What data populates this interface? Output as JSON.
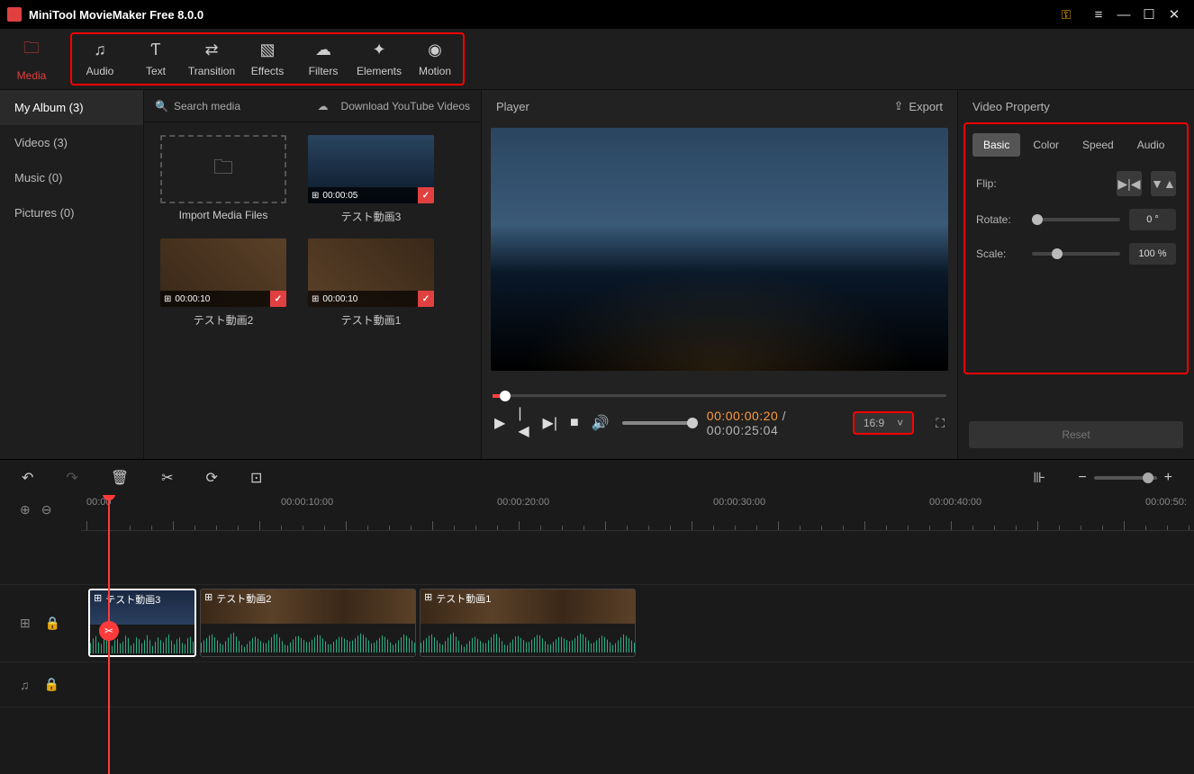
{
  "title": "MiniTool MovieMaker Free 8.0.0",
  "toolbar": {
    "media": "Media",
    "audio": "Audio",
    "text": "Text",
    "transition": "Transition",
    "effects": "Effects",
    "filters": "Filters",
    "elements": "Elements",
    "motion": "Motion"
  },
  "sidebar": {
    "album": "My Album (3)",
    "videos": "Videos (3)",
    "music": "Music (0)",
    "pictures": "Pictures (0)"
  },
  "mediaTop": {
    "search": "Search media",
    "download": "Download YouTube Videos"
  },
  "mediaItems": {
    "import": "Import Media Files",
    "i1": {
      "dur": "00:00:05",
      "name": "テスト動画3"
    },
    "i2": {
      "dur": "00:00:10",
      "name": "テスト動画2"
    },
    "i3": {
      "dur": "00:00:10",
      "name": "テスト動画1"
    }
  },
  "player": {
    "title": "Player",
    "export": "Export",
    "current": "00:00:00:20",
    "total": "00:00:25:04",
    "aspect": "16:9"
  },
  "props": {
    "title": "Video Property",
    "tabs": {
      "basic": "Basic",
      "color": "Color",
      "speed": "Speed",
      "audio": "Audio"
    },
    "flip": "Flip:",
    "rotate": "Rotate:",
    "rotateVal": "0 °",
    "scale": "Scale:",
    "scaleVal": "100 %",
    "reset": "Reset"
  },
  "ruler": {
    "t0": "00:00",
    "t1": "00:00:10:00",
    "t2": "00:00:20:00",
    "t3": "00:00:30:00",
    "t4": "00:00:40:00",
    "t5": "00:00:50:"
  },
  "clips": {
    "c1": "テスト動画3",
    "c2": "テスト動画2",
    "c3": "テスト動画1"
  }
}
